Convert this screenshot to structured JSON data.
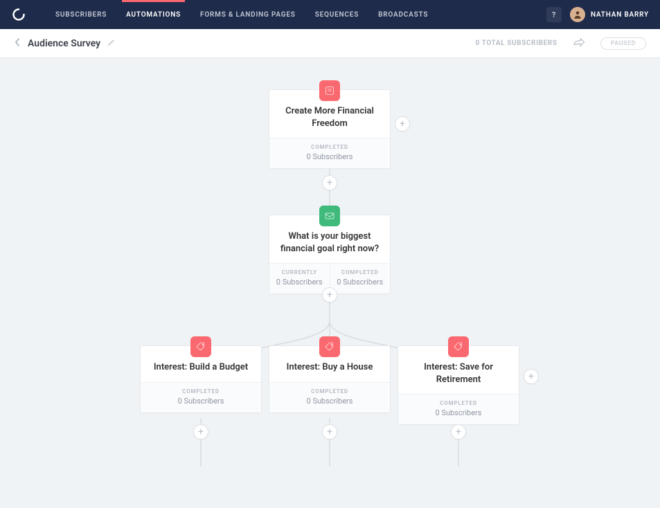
{
  "nav": {
    "items": [
      "SUBSCRIBERS",
      "AUTOMATIONS",
      "FORMS & LANDING PAGES",
      "SEQUENCES",
      "BROADCASTS"
    ],
    "active_index": 1
  },
  "help_label": "?",
  "user": {
    "name": "NATHAN BARRY"
  },
  "page": {
    "title": "Audience Survey",
    "total_subscribers": "0 TOTAL SUBSCRIBERS",
    "status": "PAUSED"
  },
  "labels": {
    "completed": "COMPLETED",
    "currently": "CURRENTLY"
  },
  "nodes": {
    "n1": {
      "title": "Create More Financial Freedom",
      "completed": "0 Subscribers"
    },
    "n2": {
      "title": "What is your biggest financial goal right now?",
      "currently": "0 Subscribers",
      "completed": "0 Subscribers"
    },
    "n3": {
      "title": "Interest: Build a Budget",
      "completed": "0 Subscribers"
    },
    "n4": {
      "title": "Interest: Buy a House",
      "completed": "0 Subscribers"
    },
    "n5": {
      "title": "Interest: Save for Retirement",
      "completed": "0 Subscribers"
    }
  }
}
